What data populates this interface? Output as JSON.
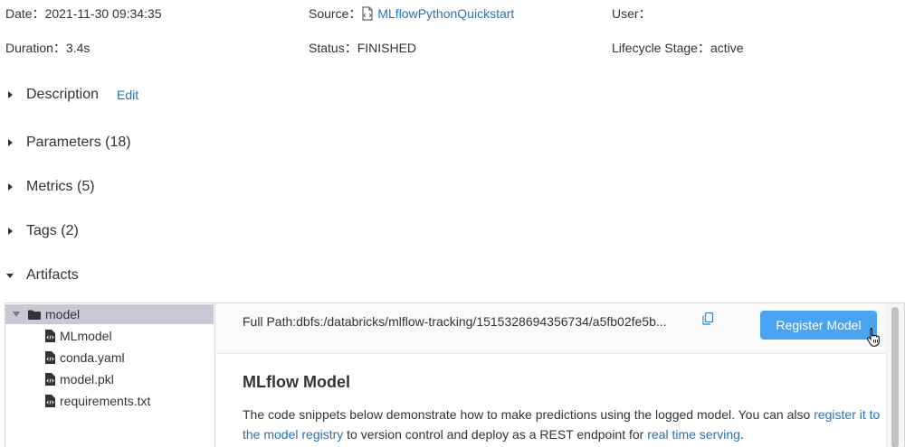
{
  "meta": {
    "date_label": "Date",
    "date_value": "2021-11-30 09:34:35",
    "source_label": "Source",
    "source_value": "MLflowPythonQuickstart",
    "user_label": "User",
    "user_value": "",
    "duration_label": "Duration",
    "duration_value": "3.4s",
    "status_label": "Status",
    "status_value": "FINISHED",
    "lifecycle_label": "Lifecycle Stage",
    "lifecycle_value": "active"
  },
  "sections": {
    "description": "Description",
    "edit": "Edit",
    "parameters": "Parameters (18)",
    "metrics": "Metrics (5)",
    "tags": "Tags (2)",
    "artifacts": "Artifacts"
  },
  "tree": {
    "folder": "model",
    "files": [
      "MLmodel",
      "conda.yaml",
      "model.pkl",
      "requirements.txt"
    ]
  },
  "viewer": {
    "full_path": "Full Path:dbfs:/databricks/mlflow-tracking/1515328694356734/a5fb02fe5b...",
    "register_button": "Register Model",
    "heading": "MLflow Model",
    "text_1": "The code snippets below demonstrate how to make predictions using the logged model. You can also ",
    "link_1": "register it to the model registry",
    "text_2": " to version control and deploy as a REST endpoint for ",
    "link_2": "real time serving",
    "text_3": "."
  },
  "icons": {
    "source": "notebook-icon",
    "copy": "copy-icon",
    "folder": "folder-icon",
    "file": "file-code-icon",
    "cursor": "hand-pointer-icon"
  },
  "colors": {
    "link": "#2374bb",
    "button": "#4aa3f0",
    "selected_row": "#c9c9d6"
  }
}
